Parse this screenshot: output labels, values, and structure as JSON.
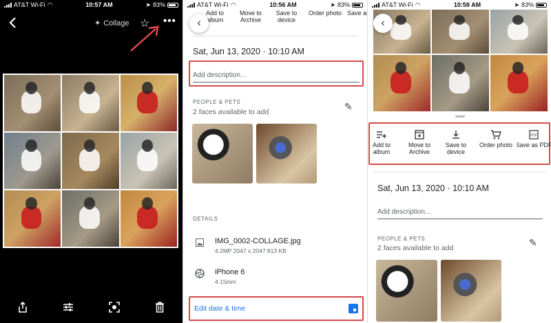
{
  "panel1": {
    "status": {
      "carrier": "AT&T Wi-Fi",
      "time": "10:57 AM",
      "battery": "83%"
    },
    "top": {
      "back_icon": "chevron-left-icon",
      "collage_label": "Collage",
      "star_icon": "star-icon",
      "more_icon": "more-dots-icon"
    },
    "bottom_icons": [
      "share-icon",
      "edit-sliders-icon",
      "lens-icon",
      "trash-icon"
    ]
  },
  "panel2": {
    "status": {
      "carrier": "AT&T Wi-Fi",
      "time": "10:56 AM",
      "battery": "83%"
    },
    "actions": [
      "Add to album",
      "Move to Archive",
      "Save to device",
      "Order photo",
      "Save as"
    ],
    "datetime": "Sat, Jun 13, 2020  ·  10:10 AM",
    "description_placeholder": "Add description...",
    "people_heading": "PEOPLE & PETS",
    "faces_text": "2 faces available to add",
    "details_heading": "DETAILS",
    "file": {
      "name": "IMG_0002-COLLAGE.jpg",
      "meta": "4.2MP   2047 x 2047   813 KB"
    },
    "camera": {
      "name": "iPhone 6",
      "meta": "4.15mm"
    },
    "edit_label": "Edit date & time"
  },
  "panel3": {
    "status": {
      "carrier": "AT&T Wi-Fi",
      "time": "10:58 AM",
      "battery": "83%"
    },
    "actions": [
      {
        "label": "Add to album",
        "icon": "playlist-add-icon"
      },
      {
        "label": "Move to Archive",
        "icon": "archive-icon"
      },
      {
        "label": "Save to device",
        "icon": "download-icon"
      },
      {
        "label": "Order photo",
        "icon": "cart-icon"
      },
      {
        "label": "Save as PDF",
        "icon": "pdf-icon"
      }
    ],
    "datetime": "Sat, Jun 13, 2020  ·  10:10 AM",
    "description_placeholder": "Add description...",
    "people_heading": "PEOPLE & PETS",
    "faces_text": "2 faces available to add"
  },
  "colors": {
    "highlight": "#d44a4a",
    "link": "#1a73e8"
  }
}
